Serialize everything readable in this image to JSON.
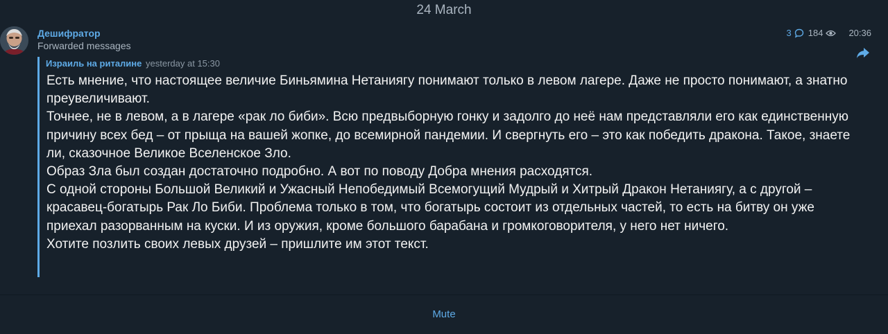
{
  "date_separator": "24 March",
  "message": {
    "sender": "Дешифратор",
    "subtitle": "Forwarded messages",
    "replies": "3",
    "views": "184",
    "time": "20:36",
    "forward": {
      "author": "Израиль на риталине",
      "time": "yesterday at 15:30",
      "paragraphs": [
        "Есть мнение, что настоящее величие Биньямина Нетаниягу понимают только в левом лагере. Даже не просто понимают, а знатно преувеличивают.",
        "Точнее, не в левом, а в лагере «рак ло биби». Всю предвыборную гонку и задолго до неё нам представляли его как единственную причину всех бед – от прыща на вашей жопке, до всемирной пандемии. И свергнуть его – это как победить дракона. Такое, знаете ли, сказочное Великое Вселенское Зло.",
        "Образ Зла был создан достаточно подробно. А вот по поводу Добра мнения расходятся.",
        "С одной стороны Большой Великий и Ужасный Непобедимый Всемогущий Мудрый и Хитрый Дракон Нетаниягу, а с другой – красавец-богатырь Рак Ло Биби. Проблема только в том, что богатырь состоит из отдельных частей, то есть на битву он уже приехал разорванным на куски. И из оружия, кроме большого барабана и громкоговорителя, у него нет ничего.",
        "Хотите позлить своих левых друзей – пришлите им этот текст."
      ]
    }
  },
  "bottom_bar": {
    "mute_label": "Mute"
  },
  "icons": {
    "replies": "comment-bubble-icon",
    "views": "eye-icon",
    "share": "share-arrow-icon"
  },
  "colors": {
    "background": "#17212b",
    "accent": "#5eaae6",
    "text": "#f2f2f2",
    "muted": "#aab5c0"
  }
}
